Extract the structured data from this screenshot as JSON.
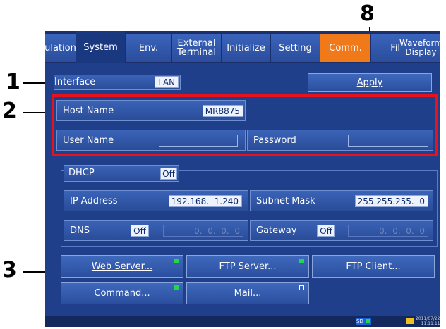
{
  "tabs": [
    {
      "label": "ulation"
    },
    {
      "label": "System"
    },
    {
      "label": "Env."
    },
    {
      "label": "External\nTerminal"
    },
    {
      "label": "Initialize"
    },
    {
      "label": "Setting"
    },
    {
      "label": "Comm."
    },
    {
      "label": "Fil"
    },
    {
      "label": "Waveform\nDisplay"
    }
  ],
  "interface": {
    "label": "Interface",
    "value": "LAN"
  },
  "apply_label": "Apply",
  "host": {
    "label": "Host Name",
    "value": "MR8875"
  },
  "user": {
    "label": "User Name",
    "value": ""
  },
  "password": {
    "label": "Password",
    "value": ""
  },
  "dhcp": {
    "label": "DHCP",
    "value": "Off"
  },
  "ip": {
    "label": "IP Address",
    "value": "192.168.  1.240"
  },
  "subnet": {
    "label": "Subnet Mask",
    "value": "255.255.255.  0"
  },
  "dns": {
    "label": "DNS",
    "toggle": "Off",
    "value": "0.  0.  0.  0"
  },
  "gateway": {
    "label": "Gateway",
    "toggle": "Off",
    "value": "0.  0.  0.  0"
  },
  "buttons": {
    "web_server": "Web Server...",
    "ftp_server": "FTP Server...",
    "ftp_client": "FTP Client...",
    "command": "Command...",
    "mail": "Mail..."
  },
  "status": {
    "sd": "SD",
    "date": "2011/07/22",
    "time": "11:11:11"
  },
  "callouts": {
    "one": "1",
    "two": "2",
    "three": "3",
    "eight": "8"
  },
  "colors": {
    "accent": "#f07a1a",
    "highlight": "#e8121d",
    "indicator_on": "#22d84a"
  }
}
